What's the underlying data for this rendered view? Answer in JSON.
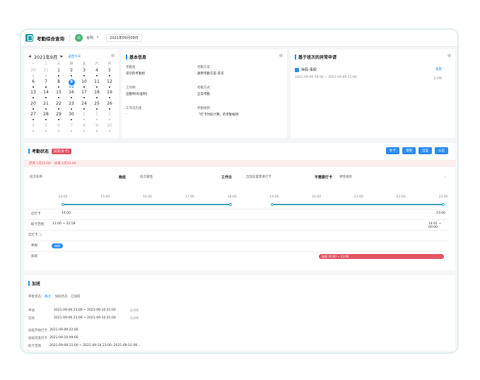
{
  "header": {
    "title": "考勤综合查询",
    "avatar_text": "G",
    "user": "肖明",
    "caret": "▾",
    "date": "2021年09月09日"
  },
  "calendar": {
    "month_label": "2021年9月",
    "prev": "◀",
    "next": "▶",
    "back_today": "返回今天",
    "weekdays": [
      "一",
      "二",
      "三",
      "四",
      "五",
      "六",
      "日"
    ],
    "weeks": [
      [
        {
          "d": "30",
          "other": true
        },
        {
          "d": "31",
          "other": true
        },
        {
          "d": "1"
        },
        {
          "d": "2"
        },
        {
          "d": "3"
        },
        {
          "d": "4"
        },
        {
          "d": "5"
        }
      ],
      [
        {
          "d": "6"
        },
        {
          "d": "7"
        },
        {
          "d": "8"
        },
        {
          "d": "9",
          "today": true
        },
        {
          "d": "10"
        },
        {
          "d": "11"
        },
        {
          "d": "12"
        }
      ],
      [
        {
          "d": "13"
        },
        {
          "d": "14"
        },
        {
          "d": "15"
        },
        {
          "d": "16"
        },
        {
          "d": "17"
        },
        {
          "d": "18"
        },
        {
          "d": "19"
        }
      ],
      [
        {
          "d": "20"
        },
        {
          "d": "21"
        },
        {
          "d": "22"
        },
        {
          "d": "23"
        },
        {
          "d": "24"
        },
        {
          "d": "25"
        },
        {
          "d": "26"
        }
      ],
      [
        {
          "d": "27"
        },
        {
          "d": "28"
        },
        {
          "d": "29"
        },
        {
          "d": "30"
        },
        {
          "d": "1",
          "other": true
        },
        {
          "d": "2",
          "other": true
        },
        {
          "d": "3",
          "other": true
        }
      ],
      [
        {
          "d": "4",
          "other": true
        },
        {
          "d": "5",
          "other": true
        },
        {
          "d": "6",
          "other": true
        },
        {
          "d": "7",
          "other": true
        },
        {
          "d": "8",
          "other": true
        },
        {
          "d": "9",
          "other": true
        },
        {
          "d": "10",
          "other": true
        }
      ]
    ]
  },
  "basic_info": {
    "title": "基本信息",
    "items": [
      {
        "label": "考勤组",
        "value": "常识的考勤组"
      },
      {
        "label": "考勤方案",
        "value": "通用考勤方案-常识"
      },
      {
        "label": "工作制",
        "value": "出勤制(标准制)"
      },
      {
        "label": "考勤方式",
        "value": "正常考勤"
      },
      {
        "label": "工作日历组",
        "value": "-"
      },
      {
        "label": "考勤规则",
        "value": "「打卡时段计算」的考勤规则"
      }
    ]
  },
  "exception": {
    "title": "基于班次的异常申请",
    "type": "休假-事假",
    "link": "查看",
    "time": "2021-09-09 09:00 ~ 2021-09-09 11:00",
    "duration": "2小时"
  },
  "attendance": {
    "title": "考勤状态",
    "status_badge": "异常(补卡)",
    "buttons": [
      "补卡",
      "请假",
      "出差",
      "公出"
    ],
    "alert": [
      "迟到 1次23:00",
      "早退 1次22:00"
    ],
    "filters": [
      {
        "label": "班次名称",
        "value": "晚班"
      },
      {
        "label": "班次属性",
        "value": "工作日"
      },
      {
        "label": "出现前置需要打卡",
        "value": "不需要打卡"
      },
      {
        "label": "",
        "value": "弹性规则"
      }
    ],
    "ticks": [
      "14:00",
      "15:00",
      "16:00",
      "17:00",
      "18:00",
      "19:00",
      "20:00",
      "21:00",
      "22:00",
      "23:00"
    ],
    "rows": {
      "punch_label": "应打卡",
      "punch_start": "14:00",
      "punch_end": "23:00",
      "range_label": "取卡范围",
      "range_start": "11:00 ~ 22:59",
      "range_end": "14:01 ~ 00:00",
      "actual_label": "实打卡 ⓘ",
      "leave_label": "休假",
      "leave_pill": "休假",
      "ot_label": "加班",
      "ot_bar": "加班 20:00 ~ 23:00"
    }
  },
  "overtime": {
    "title": "加班",
    "tab_status_label": "审批状态：",
    "tab_status_value": "通过",
    "tab_type": "加班状态：已加班",
    "rows": [
      {
        "k": "申请",
        "v": "2021-09-09 23:00 ~ 2021-09-10 01:00",
        "d": "2小时"
      },
      {
        "k": "实际",
        "v": "2021-09-09 23:00 ~ 2021-09-10 01:00",
        "d": "2小时"
      }
    ],
    "rows2": [
      {
        "k": "加班开始打卡",
        "v": "2021-09-09 22:00"
      },
      {
        "k": "加班结束打卡",
        "v": "2021-09-10 09:00"
      },
      {
        "k": "取卡范围",
        "v": "2021-09-09 11:00 ~ 2021-09-10 23:00; 2021-09-10 09..."
      }
    ]
  },
  "colors": {
    "accent": "#2d8cf0",
    "teal": "#1f9fa5",
    "danger": "#e05561",
    "timeline": "#3aa6b9"
  }
}
